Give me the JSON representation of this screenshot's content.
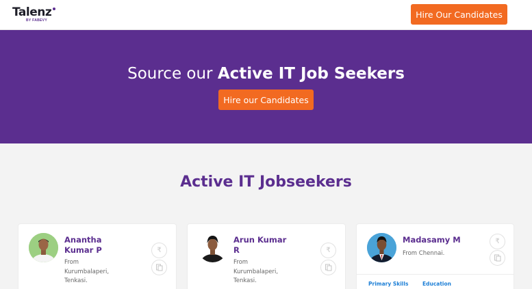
{
  "header": {
    "logo_text": "Talenz",
    "logo_subtext": "BY FABEVY",
    "cta_label": "Hire Our Candidates"
  },
  "hero": {
    "title_light": "Source our ",
    "title_bold": "Active IT Job Seekers",
    "cta_label": "Hire our Candidates"
  },
  "section": {
    "title": "Active IT Jobseekers"
  },
  "candidates": [
    {
      "name_line1": "Anantha",
      "name_line2": "Kumar P",
      "from_line1": "From",
      "from_line2": "Kurumbalaperi,",
      "from_line3": "Tenkasi."
    },
    {
      "name_line1": "Arun Kumar",
      "name_line2": "R",
      "from_line1": "From",
      "from_line2": "Kurumbalaperi,",
      "from_line3": "Tenkasi."
    },
    {
      "name_line1": "Madasamy M",
      "from_line1": "From Chennai.",
      "tabs": [
        "Primary Skills",
        "Education"
      ]
    }
  ],
  "colors": {
    "brand_purple": "#5b2e8f",
    "accent_orange": "#f26a21",
    "link_blue": "#1d7fd6"
  },
  "icons": {
    "action_primary": "coin-icon",
    "action_secondary": "resume-icon"
  }
}
